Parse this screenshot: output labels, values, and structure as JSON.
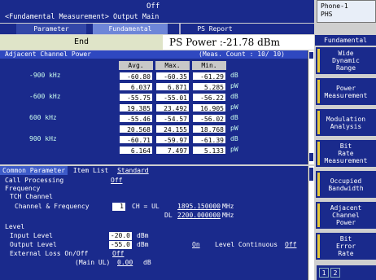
{
  "header": {
    "state": "Off",
    "title": "<Fundamental Measurement> Output Main"
  },
  "phone": {
    "line1": "Phone-1",
    "line2": "PHS"
  },
  "tabs": [
    "Parameter",
    "Fundamental",
    "PS Report"
  ],
  "status": {
    "end_label": "End",
    "ps_power": "PS Power :-21.78 dBm"
  },
  "acp": {
    "title": "Adjacent Channel Power",
    "count_label": "(Meas. Count :",
    "count_value": "10/  10)",
    "col_headers": [
      "Avg.",
      "Max.",
      "Min."
    ],
    "rows": [
      {
        "freq": "-900 kHz",
        "vals": [
          "-60.80",
          "-60.35",
          "-61.29"
        ],
        "unit": "dB"
      },
      {
        "freq": "",
        "vals": [
          "6.037",
          "6.871",
          "5.285"
        ],
        "unit": "pW"
      },
      {
        "freq": "-600 kHz",
        "vals": [
          "-55.75",
          "-55.01",
          "-56.22"
        ],
        "unit": "dB"
      },
      {
        "freq": "",
        "vals": [
          "19.385",
          "23.492",
          "16.905"
        ],
        "unit": "pW"
      },
      {
        "freq": "600 kHz",
        "vals": [
          "-55.46",
          "-54.57",
          "-56.02"
        ],
        "unit": "dB"
      },
      {
        "freq": "",
        "vals": [
          "20.568",
          "24.155",
          "18.768"
        ],
        "unit": "pW"
      },
      {
        "freq": "900 kHz",
        "vals": [
          "-60.71",
          "-59.97",
          "-61.39"
        ],
        "unit": "dB"
      },
      {
        "freq": "",
        "vals": [
          "6.164",
          "7.497",
          "5.133"
        ],
        "unit": "pW"
      }
    ]
  },
  "params": {
    "tab_common": "Common Parameter",
    "tab_itemlist": "Item List",
    "tab_standard": "Standard",
    "call_processing_label": "Call Processing",
    "call_processing_value": "Off",
    "frequency_label": "Frequency",
    "tch_label": "TCH Channel",
    "channel_freq_label": "Channel & Frequency",
    "channel_value": "1",
    "ch_label": "CH = UL",
    "ul_value": "1895.150000",
    "dl_label": "DL",
    "dl_value": "2200.000000",
    "mhz": "MHz",
    "level_label": "Level",
    "input_level_label": "Input Level",
    "input_level_value": "-20.0",
    "dbm": "dBm",
    "output_level_label": "Output Level",
    "output_level_value": "-55.0",
    "output_on": "On",
    "level_continuous_label": "Level Continuous",
    "level_continuous_value": "Off",
    "ext_loss_label": "External Loss On/Off",
    "ext_loss_value": "Off",
    "main_ul_label": "(Main UL)",
    "main_ul_value": "0.00",
    "db": "dB"
  },
  "side": {
    "header": "Fundamental",
    "buttons": [
      "Wide\nDynamic\nRange",
      "Power\nMeasurement",
      "Modulation\nAnalysis",
      "Bit\nRate\nMeasurement",
      "Occupied\nBandwidth",
      "Adjacent\nChannel\nPower",
      "Bit\nError\nRate"
    ]
  },
  "pages": [
    "1",
    "2"
  ],
  "colors": {
    "panel": "#1a2a8c",
    "accent": "#e7c93a"
  }
}
